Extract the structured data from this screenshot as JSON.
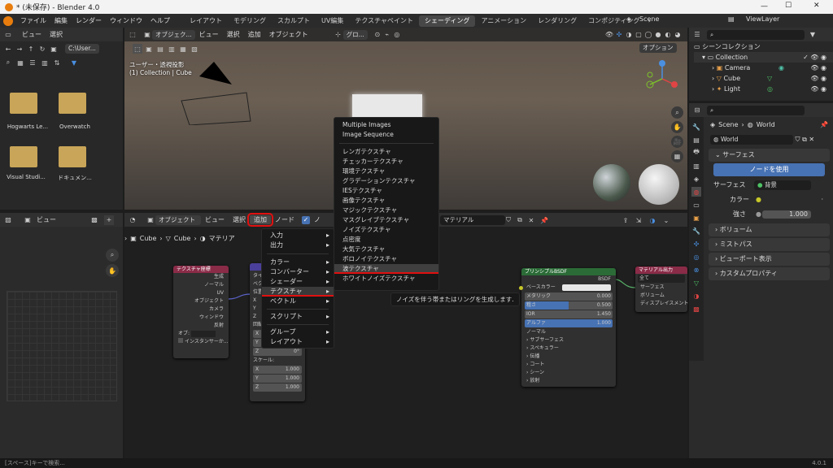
{
  "window": {
    "title": "* (未保存) - Blender 4.0"
  },
  "menubar": {
    "items": [
      "ファイル",
      "編集",
      "レンダー",
      "ウィンドウ",
      "ヘルプ"
    ],
    "workspaces": [
      "レイアウト",
      "モデリング",
      "スカルプト",
      "UV編集",
      "テクスチャペイント",
      "シェーディング",
      "アニメーション",
      "レンダリング",
      "コンポジティング"
    ],
    "scene": "Scene",
    "viewlayer": "ViewLayer"
  },
  "filebrowser": {
    "menus": [
      "ビュー",
      "選択"
    ],
    "path": "C:\\User...",
    "items": [
      "Hogwarts Le...",
      "Overwatch",
      "Visual Studi...",
      "ドキュメン..."
    ]
  },
  "viewport": {
    "mode": "オブジェク...",
    "menus": [
      "ビュー",
      "選択",
      "追加",
      "オブジェクト"
    ],
    "transform": "グロ...",
    "options": "オプション",
    "info1": "ユーザー・透視投影",
    "info2": "(1) Collection | Cube"
  },
  "imageeditor": {
    "view": "ビュー"
  },
  "nodeeditor": {
    "mode": "オブジェクト",
    "menus": [
      "ビュー",
      "選択",
      "追加",
      "ノード"
    ],
    "use_nodes": "ノ",
    "breadcrumb": [
      "Cube",
      "Cube",
      "マテリア"
    ],
    "material_slot": "マテリアル"
  },
  "add_menu": {
    "items": [
      "入力",
      "出力",
      "カラー",
      "コンバーター",
      "シェーダー",
      "テクスチャ",
      "ベクトル",
      "スクリプト",
      "グループ",
      "レイアウト"
    ]
  },
  "texture_menu": {
    "items": [
      "Multiple Images",
      "Image Sequence",
      "レンガテクスチャ",
      "チェッカーテクスチャ",
      "環境テクスチャ",
      "グラデーションテクスチャ",
      "IESテクスチャ",
      "画像テクスチャ",
      "マジックテクスチャ",
      "マスグレイブテクスチャ",
      "ノイズテクスチャ",
      "点密度",
      "大気テクスチャ",
      "ボロノイテクスチャ",
      "波テクスチャ",
      "ホワイトノイズテクスチャ"
    ],
    "tooltip": "ノイズを伴う帯またはリングを生成します."
  },
  "node_texcoord": {
    "title": "テクスチャ座標",
    "outputs": [
      "生成",
      "ノーマル",
      "UV",
      "オブジェクト",
      "カメラ",
      "ウィンドウ",
      "反射"
    ],
    "object": "オブ:",
    "instancer": "インスタンサーか..."
  },
  "node_mapping": {
    "rows": [
      "タイ",
      "ベク",
      "位置",
      "X",
      "Y",
      "Z",
      "回転",
      "X",
      "Y",
      "Z"
    ],
    "rotx": "0°",
    "roty": "0°",
    "rotz": "0°",
    "scale": "スケール:",
    "sx": "1.000",
    "sy": "1.000",
    "sz": "1.000",
    "axes": [
      "X",
      "Y",
      "Z"
    ]
  },
  "node_bsdf": {
    "title": "プリンシプルBSDF",
    "out": "BSDF",
    "base": "ベースカラー",
    "metal_l": "メタリック",
    "metal_v": "0.000",
    "rough_l": "粗さ",
    "rough_v": "0.500",
    "ior_l": "IOR",
    "ior_v": "1.450",
    "alpha_l": "アルファ",
    "alpha_v": "1.000",
    "normal": "ノーマル",
    "subs": [
      "サブサーフェス",
      "スペキュラー",
      "伝播",
      "コート",
      "シーン",
      "放射"
    ]
  },
  "node_output": {
    "title": "マテリアル出力",
    "target": "全て",
    "inputs": [
      "サーフェス",
      "ボリューム",
      "ディスプレイスメント"
    ]
  },
  "outliner": {
    "title": "シーンコレクション",
    "rows": [
      "Collection",
      "Camera",
      "Cube",
      "Light"
    ]
  },
  "properties": {
    "breadcrumb1": "Scene",
    "breadcrumb2": "World",
    "world": "World",
    "sections": [
      "サーフェス",
      "ボリューム",
      "ミストパス",
      "ビューポート表示",
      "カスタムプロパティ"
    ],
    "use_nodes": "ノードを使用",
    "surface_l": "サーフェス",
    "surface_v": "背景",
    "color_l": "カラー",
    "strength_l": "強さ",
    "strength_v": "1.000"
  },
  "statusbar": {
    "left": "[スペース]キーで検索...",
    "right": "4.0.1"
  },
  "colors": {
    "accent": "#4772b3",
    "highlight": "#e01010"
  }
}
